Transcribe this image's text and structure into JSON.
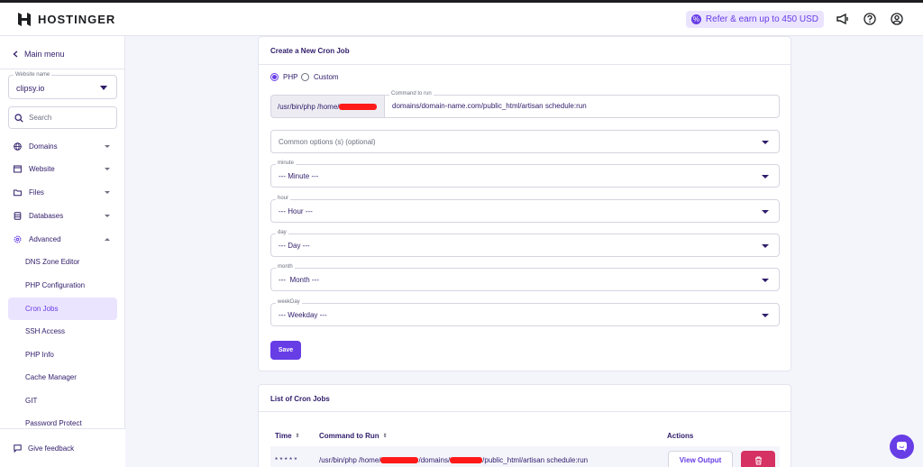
{
  "header": {
    "brand": "HOSTINGER",
    "refer_label": "Refer & earn up to 450 USD"
  },
  "sidebar": {
    "main_menu": "Main menu",
    "website_select": {
      "label": "Website name",
      "value": "clipsy.io"
    },
    "search_placeholder": "Search",
    "items": [
      {
        "label": "Domains",
        "icon": "globe-icon"
      },
      {
        "label": "Website",
        "icon": "window-icon"
      },
      {
        "label": "Files",
        "icon": "folder-icon"
      },
      {
        "label": "Databases",
        "icon": "database-icon"
      },
      {
        "label": "Advanced",
        "icon": "gear-icon"
      }
    ],
    "sub_items": [
      {
        "label": "DNS Zone Editor"
      },
      {
        "label": "PHP Configuration"
      },
      {
        "label": "Cron Jobs",
        "active": true
      },
      {
        "label": "SSH Access"
      },
      {
        "label": "PHP Info"
      },
      {
        "label": "Cache Manager"
      },
      {
        "label": "GIT"
      },
      {
        "label": "Password Protect"
      }
    ],
    "feedback": "Give feedback"
  },
  "create_card": {
    "title": "Create a New Cron Job",
    "radio_php": "PHP",
    "radio_custom": "Custom",
    "command_prefix": "/usr/bin/php /home/",
    "command_label": "Command to run",
    "command_value": "domains/domain-name.com/public_html/artisan schedule:run",
    "common_options_placeholder": "Common options (s) (optional)",
    "selects": [
      {
        "label": "minute",
        "value": "--- Minute ---"
      },
      {
        "label": "hour",
        "value": "--- Hour ---"
      },
      {
        "label": "day",
        "value": "--- Day ---"
      },
      {
        "label": "month",
        "value": "---  Month ---"
      },
      {
        "label": "weekDay",
        "value": "--- Weekday ---"
      }
    ],
    "save_label": "Save"
  },
  "list_card": {
    "title": "List of Cron Jobs",
    "columns": {
      "time": "Time",
      "command": "Command to Run",
      "actions": "Actions"
    },
    "row": {
      "time": "* * * * *",
      "cmd_part1": "/usr/bin/php /home/",
      "cmd_part2": "/domains/",
      "cmd_part3": "/public_html/artisan schedule:run",
      "view_label": "View Output"
    }
  },
  "colors": {
    "accent": "#673de6",
    "danger": "#d63163",
    "redaction": "#ff1a1a"
  }
}
